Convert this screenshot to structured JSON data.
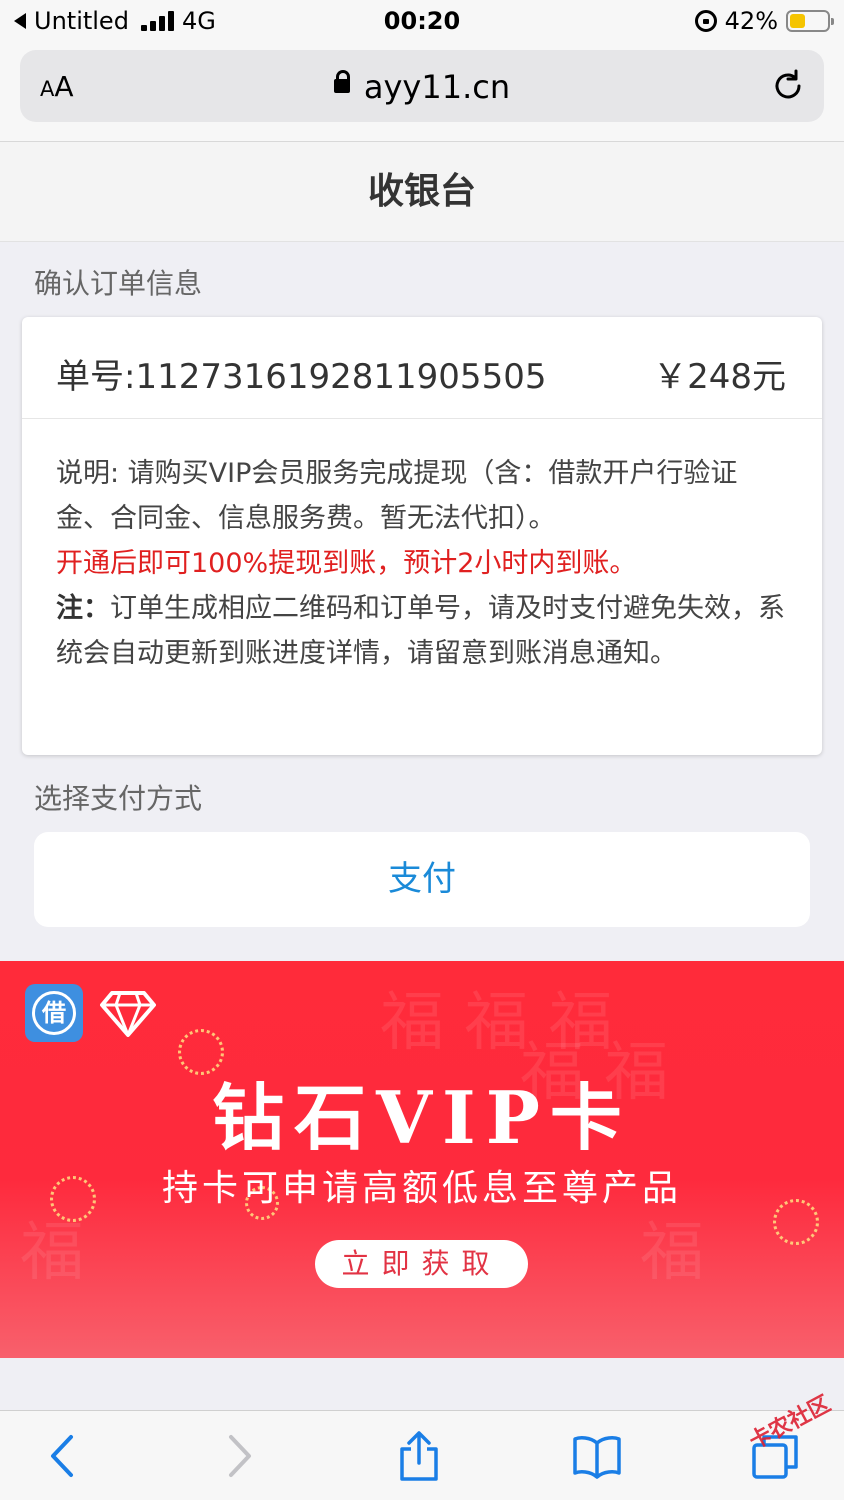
{
  "status_bar": {
    "back_app": "Untitled",
    "network": "4G",
    "time": "00:20",
    "battery": "42%",
    "battery_level": 0.42
  },
  "browser": {
    "text_size_label": "AA",
    "url": "ayy11.cn"
  },
  "page": {
    "title": "收银台"
  },
  "order_section": {
    "label": "确认订单信息",
    "order_number": "单号:1127316192811905505",
    "price": "￥248元",
    "description_1": "说明: 请购买VIP会员服务完成提现（含：借款开户行验证金、合同金、信息服务费。暂无法代扣）。",
    "description_red": "开通后即可100%提现到账，预计2小时内到账。",
    "note_label": "注：",
    "note_text": "订单生成相应二维码和订单号，请及时支付避免失效，系统会自动更新到账进度详情，请留意到账消息通知。"
  },
  "payment_section": {
    "label": "选择支付方式",
    "pay_button": "支付",
    "pay_button_color": "#1a8ad8"
  },
  "banner": {
    "logo_char": "借",
    "title": "钻石VIP卡",
    "subtitle": "持卡可申请高额低息至尊产品",
    "cta": "立即获取",
    "bg_color": "#ff2b3a"
  },
  "watermark": "卡农社区"
}
